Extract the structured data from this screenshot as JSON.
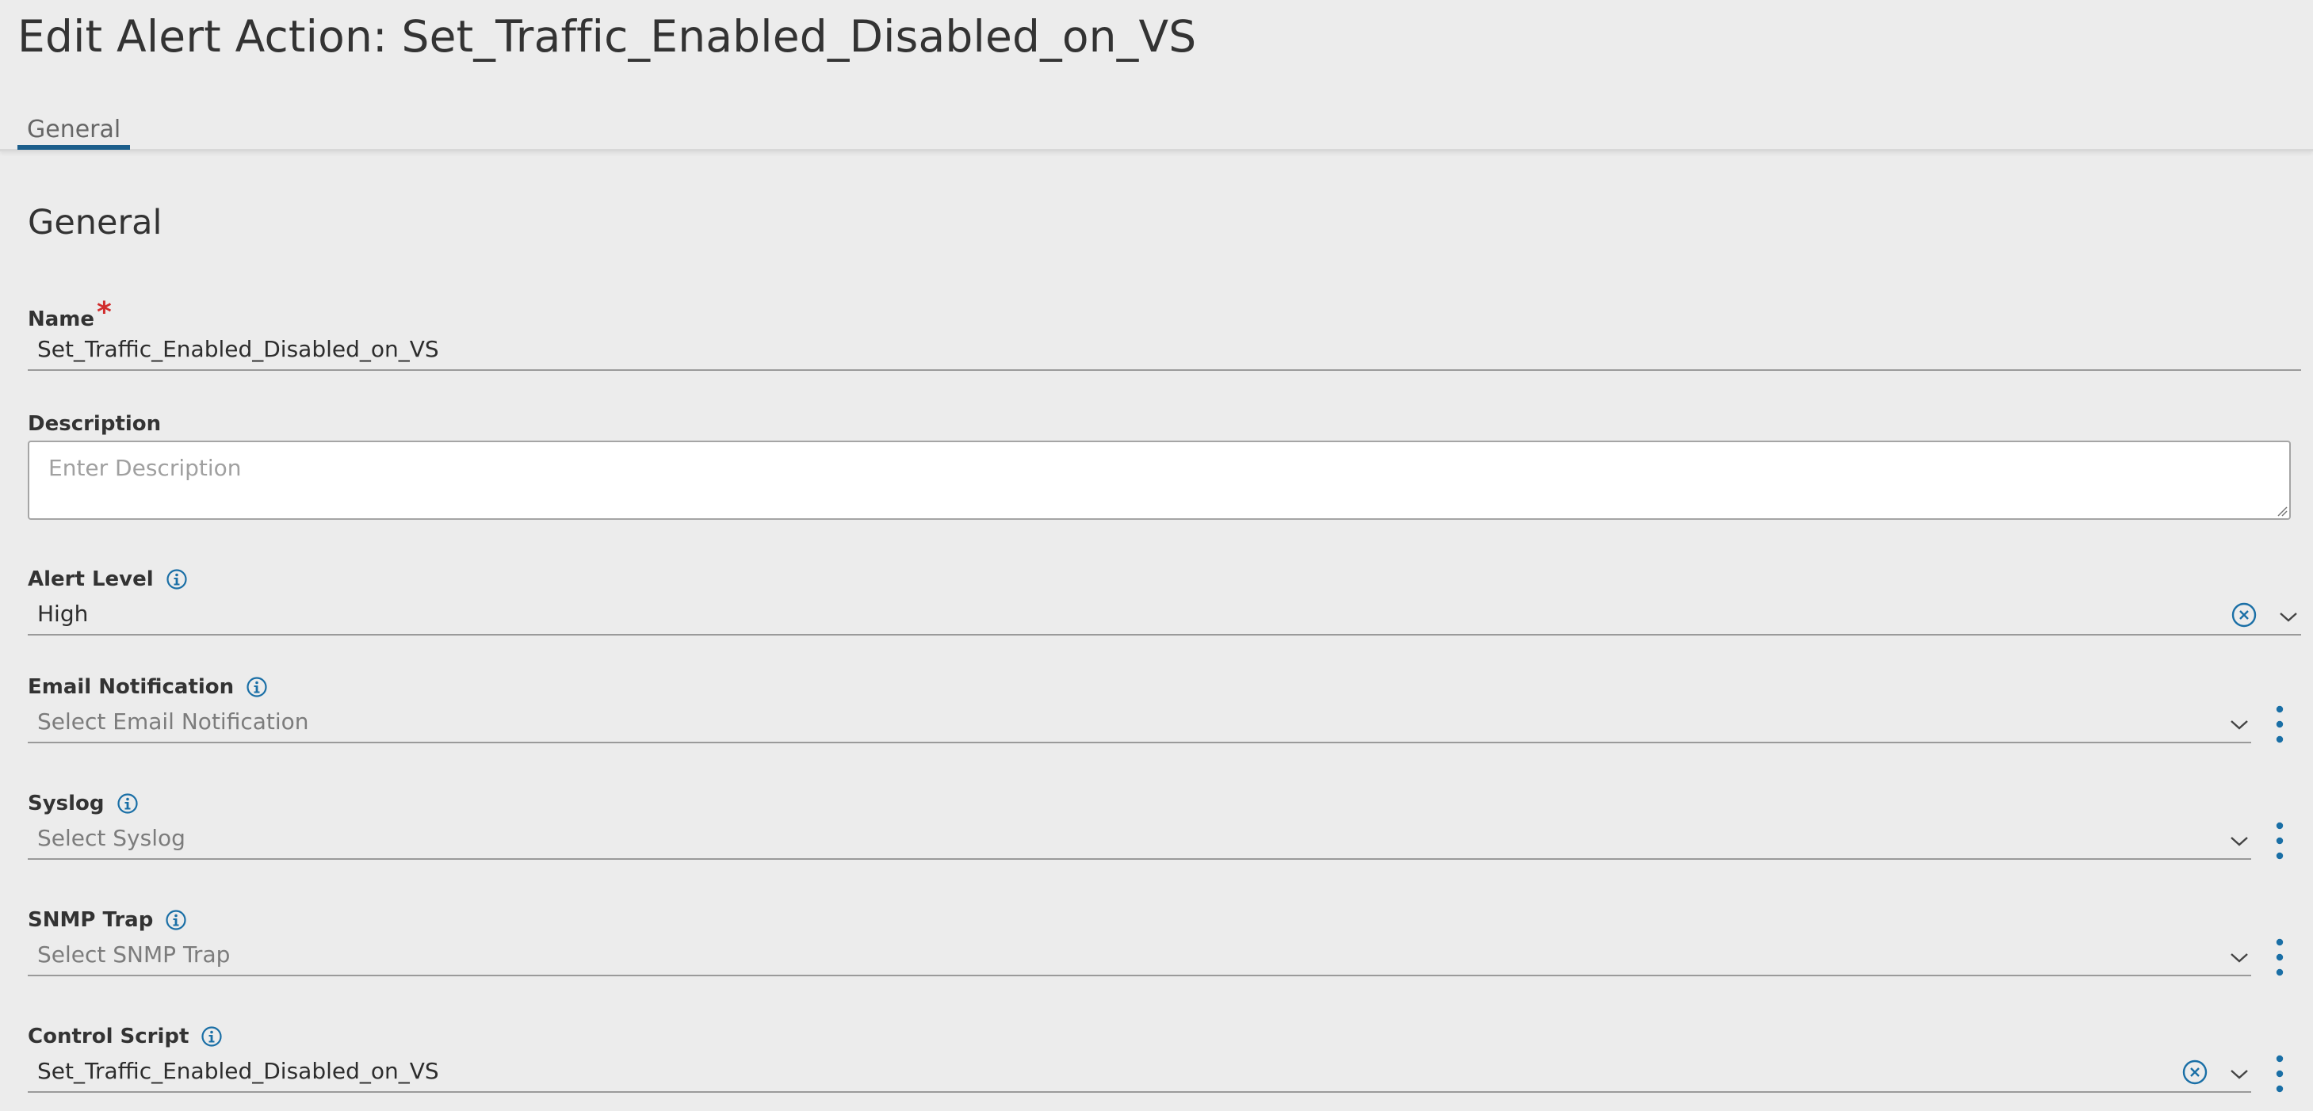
{
  "page": {
    "title": "Edit Alert Action: Set_Traffic_Enabled_Disabled_on_VS"
  },
  "tabs": [
    {
      "label": "General",
      "active": true
    }
  ],
  "section": {
    "title": "General"
  },
  "fields": {
    "name": {
      "label": "Name",
      "required_mark": "*",
      "value": "Set_Traffic_Enabled_Disabled_on_VS"
    },
    "description": {
      "label": "Description",
      "placeholder": "Enter Description",
      "value": ""
    },
    "alert_level": {
      "label": "Alert Level",
      "value": "High"
    },
    "email_notification": {
      "label": "Email Notification",
      "placeholder": "Select Email Notification"
    },
    "syslog": {
      "label": "Syslog",
      "placeholder": "Select Syslog"
    },
    "snmp_trap": {
      "label": "SNMP Trap",
      "placeholder": "Select SNMP Trap"
    },
    "control_script": {
      "label": "Control Script",
      "value": "Set_Traffic_Enabled_Disabled_on_VS"
    }
  },
  "colors": {
    "accent": "#1d5f8c",
    "icon": "#1a6fa6",
    "required": "#d12d2d",
    "background": "#ececec"
  },
  "icons": {
    "info": "info-circle-icon",
    "clear": "clear-circle-icon",
    "dropdown": "chevron-down-icon",
    "menu": "vertical-ellipsis-icon"
  }
}
